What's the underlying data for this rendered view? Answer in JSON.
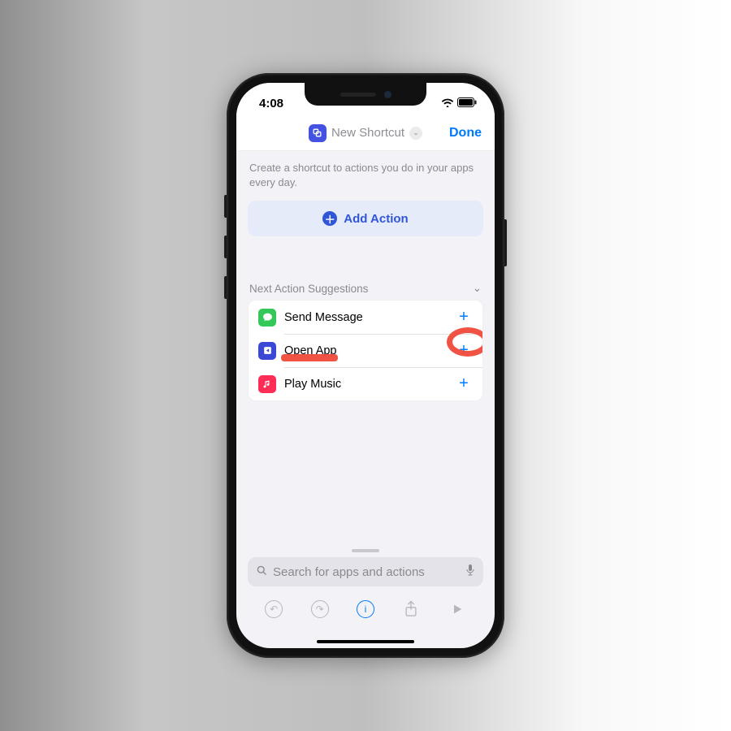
{
  "status": {
    "time": "4:08"
  },
  "header": {
    "title": "New Shortcut",
    "done": "Done"
  },
  "intro": "Create a shortcut to actions you do in your apps every day.",
  "addActionLabel": "Add Action",
  "suggestions": {
    "title": "Next Action Suggestions",
    "items": [
      {
        "label": "Send Message",
        "iconColor": "green",
        "iconGlyph": "✉"
      },
      {
        "label": "Open App",
        "iconColor": "blue",
        "iconGlyph": "◧"
      },
      {
        "label": "Play Music",
        "iconColor": "red",
        "iconGlyph": "♪"
      }
    ]
  },
  "search": {
    "placeholder": "Search for apps and actions"
  }
}
